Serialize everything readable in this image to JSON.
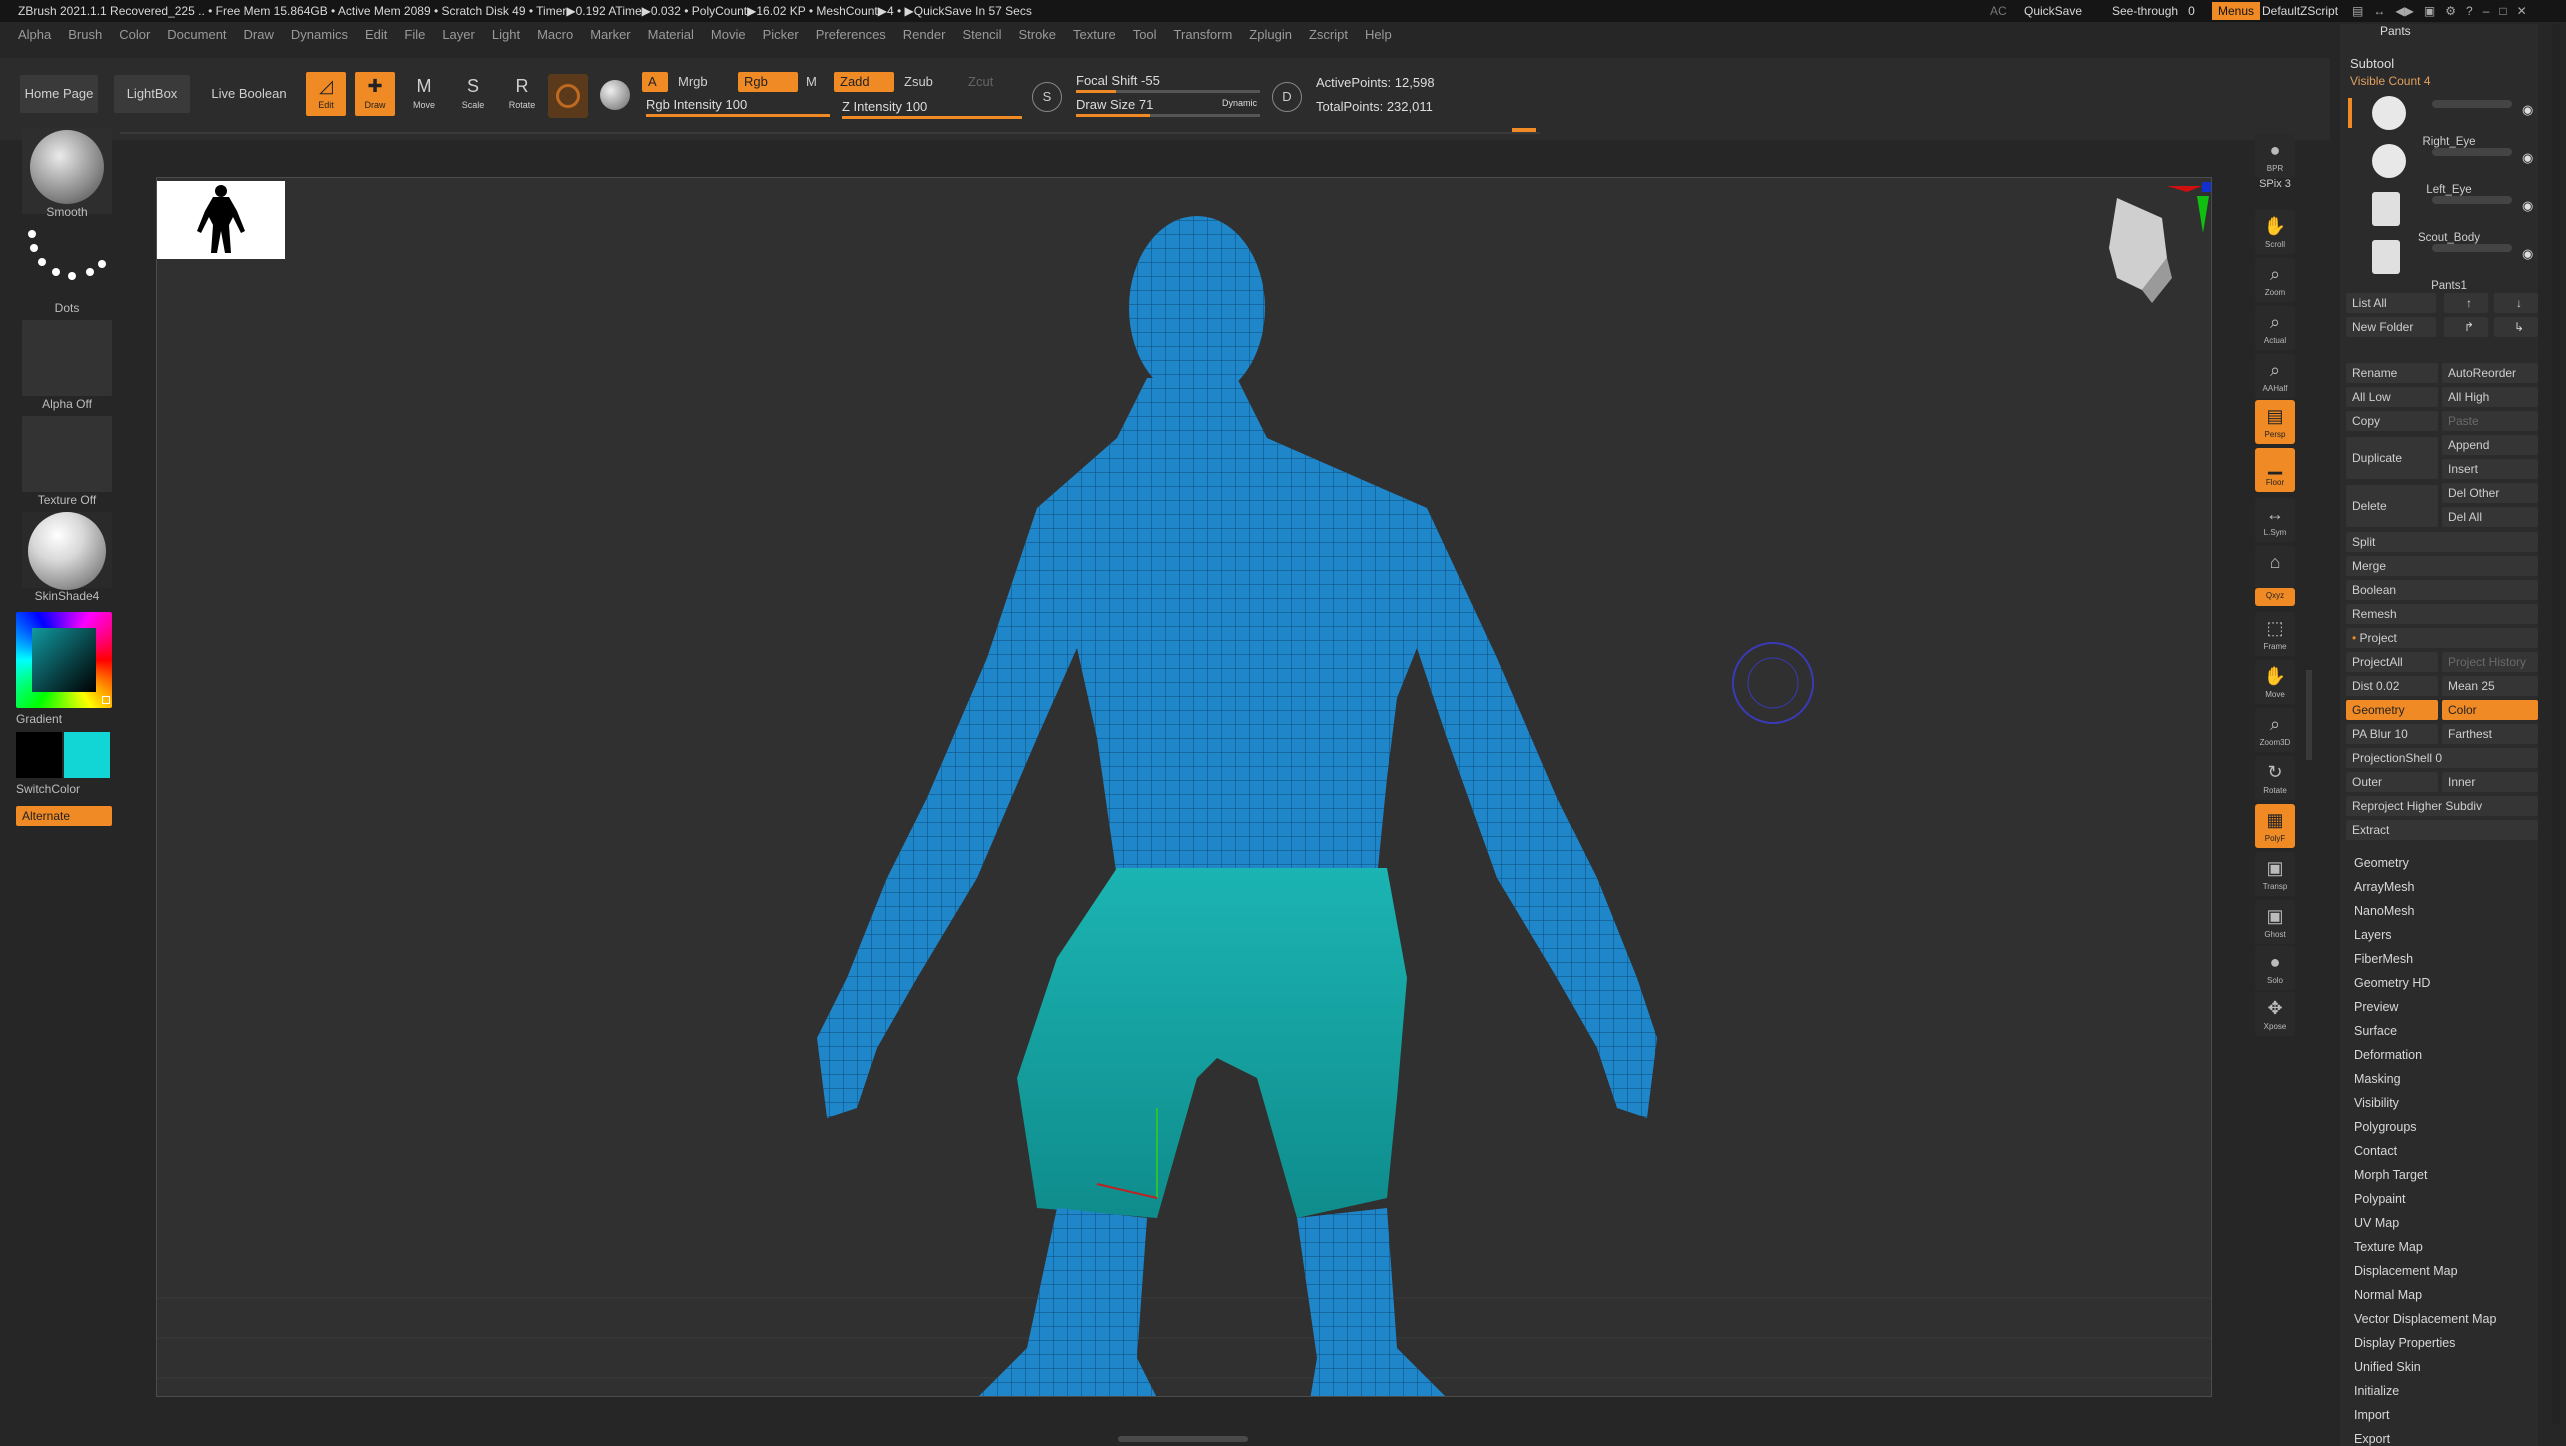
{
  "titlebar": {
    "app_title": "ZBrush 2021.1.1   Recovered_225   .. • Free Mem 15.864GB • Active Mem 2089 • Scratch Disk 49 •  Timer▶0.192 ATime▶0.032 • PolyCount▶16.02 KP • MeshCount▶4 • ▶QuickSave In 57 Secs",
    "ac": "AC",
    "quicksave": "QuickSave",
    "see_through": "See-through",
    "see_through_value": "0",
    "menus": "Menus",
    "script": "DefaultZScript"
  },
  "menubar": [
    "Alpha",
    "Brush",
    "Color",
    "Document",
    "Draw",
    "Dynamics",
    "Edit",
    "File",
    "Layer",
    "Light",
    "Macro",
    "Marker",
    "Material",
    "Movie",
    "Picker",
    "Preferences",
    "Render",
    "Stencil",
    "Stroke",
    "Texture",
    "Tool",
    "Transform",
    "Zplugin",
    "Zscript",
    "Help"
  ],
  "shelf": {
    "home_page": "Home Page",
    "lightbox": "LightBox",
    "live_boolean": "Live Boolean",
    "tools": [
      {
        "label": "Edit",
        "active": true,
        "glyph": "◿"
      },
      {
        "label": "Draw",
        "active": true,
        "glyph": "✚"
      },
      {
        "label": "Move",
        "active": false,
        "glyph": "M"
      },
      {
        "label": "Scale",
        "active": false,
        "glyph": "S"
      },
      {
        "label": "Rotate",
        "active": false,
        "glyph": "R"
      }
    ],
    "a_label": "A",
    "mrgb": "Mrgb",
    "rgb": "Rgb",
    "m": "M",
    "rgb_intensity_label": "Rgb Intensity",
    "rgb_intensity_value": "100",
    "rgb_intensity_fraction": 1.0,
    "zadd": "Zadd",
    "zsub": "Zsub",
    "zcut": "Zcut",
    "z_intensity_label": "Z Intensity",
    "z_intensity_value": "100",
    "z_intensity_fraction": 1.0,
    "s_label": "S",
    "focal_shift_label": "Focal Shift",
    "focal_shift_value": "-55",
    "focal_shift_fraction": 0.22,
    "draw_size_label": "Draw Size",
    "draw_size_value": "71",
    "draw_size_fraction": 0.4,
    "dynamic": "Dynamic",
    "d_label": "D",
    "active_points_label": "ActivePoints:",
    "active_points_value": "12,598",
    "total_points_label": "TotalPoints:",
    "total_points_value": "232,011"
  },
  "left": {
    "brush": "Smooth",
    "stroke": "Dots",
    "alpha": "Alpha Off",
    "texture": "Texture Off",
    "material": "SkinShade4",
    "gradient": "Gradient",
    "switch_color": "SwitchColor",
    "alternate": "Alternate",
    "primary_color": "#000000",
    "secondary_color": "#12d6d6"
  },
  "viewport": {
    "skin_color": "#1f86c9",
    "pants_color": "#16a8a8"
  },
  "right_toolbar": [
    {
      "label": "BPR",
      "active": false,
      "glyph": "●"
    },
    {
      "label": "SPix",
      "value": "3"
    },
    {
      "label": "Scroll",
      "active": false,
      "glyph": "✋"
    },
    {
      "label": "Zoom",
      "active": false,
      "glyph": "⌕"
    },
    {
      "label": "Actual",
      "active": false,
      "glyph": "⌕"
    },
    {
      "label": "AAHalf",
      "active": false,
      "glyph": "⌕"
    },
    {
      "label": "Persp",
      "active": true,
      "glyph": "▤"
    },
    {
      "label": "Floor",
      "active": true,
      "glyph": "▁"
    },
    {
      "label": "L.Sym",
      "active": false,
      "glyph": "↔"
    },
    {
      "label": "",
      "active": false,
      "glyph": "⌂"
    },
    {
      "label": "Qxyz",
      "active": true,
      "glyph": ""
    },
    {
      "label": "Frame",
      "active": false,
      "glyph": "⬚"
    },
    {
      "label": "Move",
      "active": false,
      "glyph": "✋"
    },
    {
      "label": "Zoom3D",
      "active": false,
      "glyph": "⌕"
    },
    {
      "label": "Rotate",
      "active": false,
      "glyph": "↻"
    },
    {
      "label": "PolyF",
      "active": true,
      "glyph": "▦"
    },
    {
      "label": "Transp",
      "active": false,
      "glyph": "▣"
    },
    {
      "label": "Ghost",
      "active": false,
      "glyph": "▣"
    },
    {
      "label": "Solo",
      "active": false,
      "glyph": "●"
    },
    {
      "label": "Xpose",
      "active": false,
      "glyph": "✥"
    }
  ],
  "subtool": {
    "header_tab": "Pants",
    "title": "Subtool",
    "visible_count": "Visible Count 4",
    "items": [
      "Right_Eye",
      "Left_Eye",
      "Scout_Body",
      "Pants1"
    ],
    "list_all": "List All",
    "new_folder": "New Folder",
    "rename": "Rename",
    "autoreorder": "AutoReorder",
    "all_low": "All Low",
    "all_high": "All High",
    "copy": "Copy",
    "paste": "Paste",
    "duplicate": "Duplicate",
    "append": "Append",
    "insert": "Insert",
    "delete": "Delete",
    "del_other": "Del Other",
    "del_all": "Del All",
    "split": "Split",
    "merge": "Merge",
    "boolean": "Boolean",
    "remesh": "Remesh",
    "project": "Project",
    "project_all": "ProjectAll",
    "project_history": "Project History",
    "dist_label": "Dist",
    "dist_value": "0.02",
    "mean_label": "Mean",
    "mean_value": "25",
    "geometry_toggle": "Geometry",
    "color_toggle": "Color",
    "pa_blur_label": "PA Blur",
    "pa_blur_value": "10",
    "farthest": "Farthest",
    "projection_shell_label": "ProjectionShell",
    "projection_shell_value": "0",
    "outer": "Outer",
    "inner": "Inner",
    "reproject": "Reproject Higher Subdiv",
    "extract": "Extract"
  },
  "tool_sections": [
    "Geometry",
    "ArrayMesh",
    "NanoMesh",
    "Layers",
    "FiberMesh",
    "Geometry HD",
    "Preview",
    "Surface",
    "Deformation",
    "Masking",
    "Visibility",
    "Polygroups",
    "Contact",
    "Morph Target",
    "Polypaint",
    "UV Map",
    "Texture Map",
    "Displacement Map",
    "Normal Map",
    "Vector Displacement Map",
    "Display Properties",
    "Unified Skin",
    "Initialize",
    "Import",
    "Export"
  ]
}
